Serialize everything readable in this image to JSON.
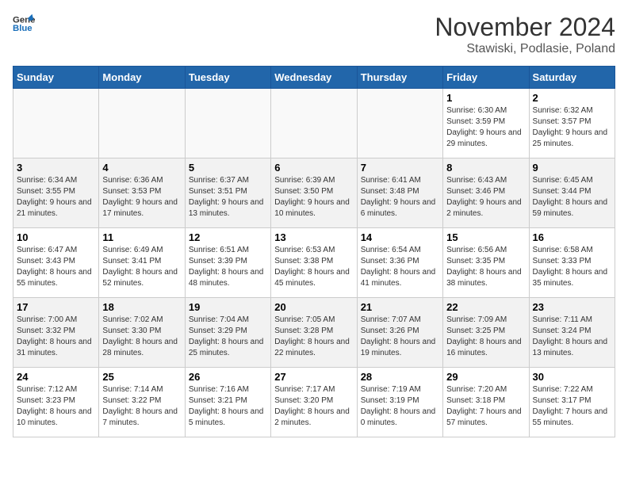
{
  "logo": {
    "line1": "General",
    "line2": "Blue"
  },
  "title": "November 2024",
  "subtitle": "Stawiski, Podlasie, Poland",
  "headers": [
    "Sunday",
    "Monday",
    "Tuesday",
    "Wednesday",
    "Thursday",
    "Friday",
    "Saturday"
  ],
  "weeks": [
    [
      {
        "day": "",
        "info": ""
      },
      {
        "day": "",
        "info": ""
      },
      {
        "day": "",
        "info": ""
      },
      {
        "day": "",
        "info": ""
      },
      {
        "day": "",
        "info": ""
      },
      {
        "day": "1",
        "info": "Sunrise: 6:30 AM\nSunset: 3:59 PM\nDaylight: 9 hours and 29 minutes."
      },
      {
        "day": "2",
        "info": "Sunrise: 6:32 AM\nSunset: 3:57 PM\nDaylight: 9 hours and 25 minutes."
      }
    ],
    [
      {
        "day": "3",
        "info": "Sunrise: 6:34 AM\nSunset: 3:55 PM\nDaylight: 9 hours and 21 minutes."
      },
      {
        "day": "4",
        "info": "Sunrise: 6:36 AM\nSunset: 3:53 PM\nDaylight: 9 hours and 17 minutes."
      },
      {
        "day": "5",
        "info": "Sunrise: 6:37 AM\nSunset: 3:51 PM\nDaylight: 9 hours and 13 minutes."
      },
      {
        "day": "6",
        "info": "Sunrise: 6:39 AM\nSunset: 3:50 PM\nDaylight: 9 hours and 10 minutes."
      },
      {
        "day": "7",
        "info": "Sunrise: 6:41 AM\nSunset: 3:48 PM\nDaylight: 9 hours and 6 minutes."
      },
      {
        "day": "8",
        "info": "Sunrise: 6:43 AM\nSunset: 3:46 PM\nDaylight: 9 hours and 2 minutes."
      },
      {
        "day": "9",
        "info": "Sunrise: 6:45 AM\nSunset: 3:44 PM\nDaylight: 8 hours and 59 minutes."
      }
    ],
    [
      {
        "day": "10",
        "info": "Sunrise: 6:47 AM\nSunset: 3:43 PM\nDaylight: 8 hours and 55 minutes."
      },
      {
        "day": "11",
        "info": "Sunrise: 6:49 AM\nSunset: 3:41 PM\nDaylight: 8 hours and 52 minutes."
      },
      {
        "day": "12",
        "info": "Sunrise: 6:51 AM\nSunset: 3:39 PM\nDaylight: 8 hours and 48 minutes."
      },
      {
        "day": "13",
        "info": "Sunrise: 6:53 AM\nSunset: 3:38 PM\nDaylight: 8 hours and 45 minutes."
      },
      {
        "day": "14",
        "info": "Sunrise: 6:54 AM\nSunset: 3:36 PM\nDaylight: 8 hours and 41 minutes."
      },
      {
        "day": "15",
        "info": "Sunrise: 6:56 AM\nSunset: 3:35 PM\nDaylight: 8 hours and 38 minutes."
      },
      {
        "day": "16",
        "info": "Sunrise: 6:58 AM\nSunset: 3:33 PM\nDaylight: 8 hours and 35 minutes."
      }
    ],
    [
      {
        "day": "17",
        "info": "Sunrise: 7:00 AM\nSunset: 3:32 PM\nDaylight: 8 hours and 31 minutes."
      },
      {
        "day": "18",
        "info": "Sunrise: 7:02 AM\nSunset: 3:30 PM\nDaylight: 8 hours and 28 minutes."
      },
      {
        "day": "19",
        "info": "Sunrise: 7:04 AM\nSunset: 3:29 PM\nDaylight: 8 hours and 25 minutes."
      },
      {
        "day": "20",
        "info": "Sunrise: 7:05 AM\nSunset: 3:28 PM\nDaylight: 8 hours and 22 minutes."
      },
      {
        "day": "21",
        "info": "Sunrise: 7:07 AM\nSunset: 3:26 PM\nDaylight: 8 hours and 19 minutes."
      },
      {
        "day": "22",
        "info": "Sunrise: 7:09 AM\nSunset: 3:25 PM\nDaylight: 8 hours and 16 minutes."
      },
      {
        "day": "23",
        "info": "Sunrise: 7:11 AM\nSunset: 3:24 PM\nDaylight: 8 hours and 13 minutes."
      }
    ],
    [
      {
        "day": "24",
        "info": "Sunrise: 7:12 AM\nSunset: 3:23 PM\nDaylight: 8 hours and 10 minutes."
      },
      {
        "day": "25",
        "info": "Sunrise: 7:14 AM\nSunset: 3:22 PM\nDaylight: 8 hours and 7 minutes."
      },
      {
        "day": "26",
        "info": "Sunrise: 7:16 AM\nSunset: 3:21 PM\nDaylight: 8 hours and 5 minutes."
      },
      {
        "day": "27",
        "info": "Sunrise: 7:17 AM\nSunset: 3:20 PM\nDaylight: 8 hours and 2 minutes."
      },
      {
        "day": "28",
        "info": "Sunrise: 7:19 AM\nSunset: 3:19 PM\nDaylight: 8 hours and 0 minutes."
      },
      {
        "day": "29",
        "info": "Sunrise: 7:20 AM\nSunset: 3:18 PM\nDaylight: 7 hours and 57 minutes."
      },
      {
        "day": "30",
        "info": "Sunrise: 7:22 AM\nSunset: 3:17 PM\nDaylight: 7 hours and 55 minutes."
      }
    ]
  ]
}
